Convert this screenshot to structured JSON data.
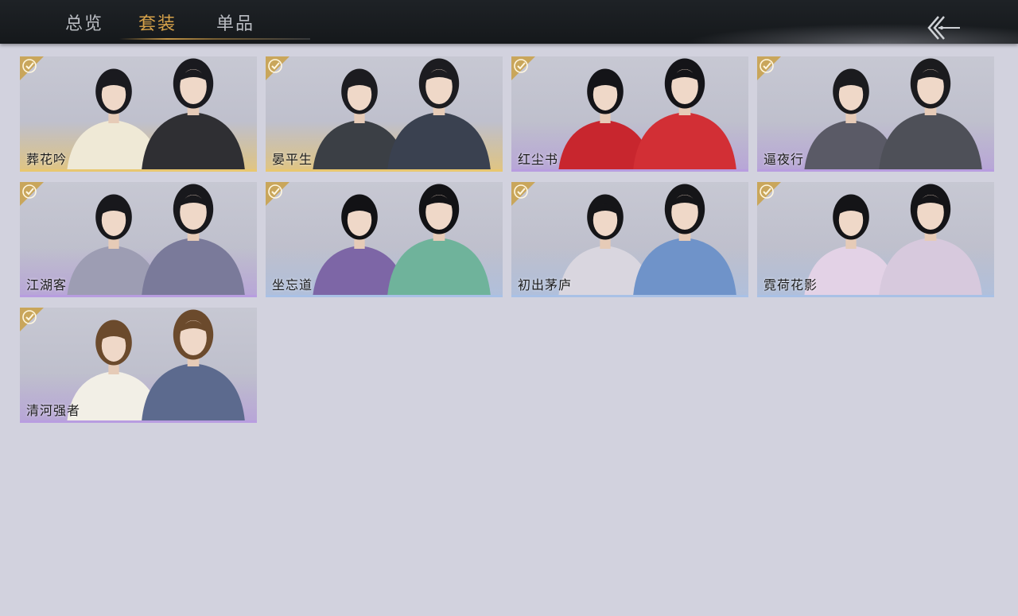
{
  "tabs": [
    {
      "label": "总览",
      "active": false
    },
    {
      "label": "套装",
      "active": true
    },
    {
      "label": "单品",
      "active": false
    }
  ],
  "back_icon": "back-arrow-icon",
  "colors": {
    "active_tab": "#d6a24a",
    "inactive_tab": "#b9bcc2",
    "background": "#d2d2de",
    "check_badge": "#c9a24e"
  },
  "outfits": [
    {
      "name": "葬花吟",
      "rarity": "gold",
      "owned": true,
      "hair": "#1a1a1f",
      "outfitA": "#efe9d6",
      "outfitB": "#2f2f33"
    },
    {
      "name": "晏平生",
      "rarity": "gold",
      "owned": true,
      "hair": "#1c1c20",
      "outfitA": "#3b3f45",
      "outfitB": "#3a4150"
    },
    {
      "name": "红尘书",
      "rarity": "purple",
      "owned": true,
      "hair": "#141418",
      "outfitA": "#c8262e",
      "outfitB": "#d22f35"
    },
    {
      "name": "逼夜行",
      "rarity": "purple",
      "owned": true,
      "hair": "#1b1b1e",
      "outfitA": "#5a5a66",
      "outfitB": "#4e5058"
    },
    {
      "name": "江湖客",
      "rarity": "purple",
      "owned": true,
      "hair": "#18181c",
      "outfitA": "#9d9db3",
      "outfitB": "#7a7a9a"
    },
    {
      "name": "坐忘道",
      "rarity": "blue",
      "owned": true,
      "hair": "#121215",
      "outfitA": "#7d66a6",
      "outfitB": "#6fb39b"
    },
    {
      "name": "初出茅庐",
      "rarity": "blue",
      "owned": true,
      "hair": "#151518",
      "outfitA": "#d9d6df",
      "outfitB": "#6f93c9"
    },
    {
      "name": "霓荷花影",
      "rarity": "blue",
      "owned": true,
      "hair": "#141417",
      "outfitA": "#e3d2e6",
      "outfitB": "#d7c9dd"
    },
    {
      "name": "清河强者",
      "rarity": "purple",
      "owned": true,
      "hair": "#6b4a2c",
      "outfitA": "#f2efe6",
      "outfitB": "#5c6a8e"
    }
  ]
}
